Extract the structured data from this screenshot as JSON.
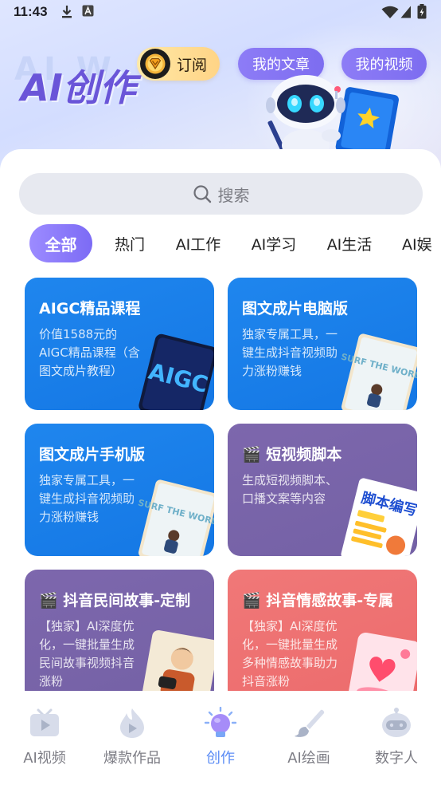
{
  "status": {
    "time": "11:43"
  },
  "header": {
    "brand": "AI创作",
    "brand_ghost": "AI W",
    "subscribe_label": "订阅",
    "my_articles_label": "我的文章",
    "my_videos_label": "我的视频"
  },
  "search": {
    "placeholder": "搜索"
  },
  "tabs": [
    {
      "label": "全部",
      "active": true
    },
    {
      "label": "热门"
    },
    {
      "label": "AI工作"
    },
    {
      "label": "AI学习"
    },
    {
      "label": "AI生活"
    },
    {
      "label": "AI娱"
    }
  ],
  "cards": [
    {
      "title": "AIGC精品课程",
      "desc": "价值1588元的AIGC精品课程（含图文成片教程）",
      "art_text": "AIGC"
    },
    {
      "title": "图文成片电脑版",
      "desc": "独家专属工具，一键生成抖音视频助力涨粉赚钱",
      "art_text": "SURF THE WORLD"
    },
    {
      "title": "图文成片手机版",
      "desc": "独家专属工具，一键生成抖音视频助力涨粉赚钱",
      "art_text": "SURF THE WORLD"
    },
    {
      "title": "🎬 短视频脚本",
      "desc": "生成短视频脚本、口播文案等内容",
      "art_text": "脚本编写"
    },
    {
      "title": "🎬 抖音民间故事-定制",
      "desc": "【独家】AI深度优化，一键批量生成民间故事视频抖音涨粉"
    },
    {
      "title": "🎬 抖音情感故事-专属",
      "desc": "【独家】AI深度优化，一键批量生成多种情感故事助力抖音涨粉"
    }
  ],
  "bottom_nav": [
    {
      "label": "AI视频",
      "icon": "tv-play-icon"
    },
    {
      "label": "爆款作品",
      "icon": "fire-play-icon"
    },
    {
      "label": "创作",
      "icon": "lightbulb-icon",
      "active": true
    },
    {
      "label": "AI绘画",
      "icon": "paintbrush-icon"
    },
    {
      "label": "数字人",
      "icon": "robot-head-icon"
    }
  ],
  "colors": {
    "accent_purple": "#7c6bf5",
    "card_blue": "#1477e4",
    "card_purple": "#7461a5",
    "card_red": "#ec6b6c",
    "nav_active": "#5b8cf5"
  }
}
